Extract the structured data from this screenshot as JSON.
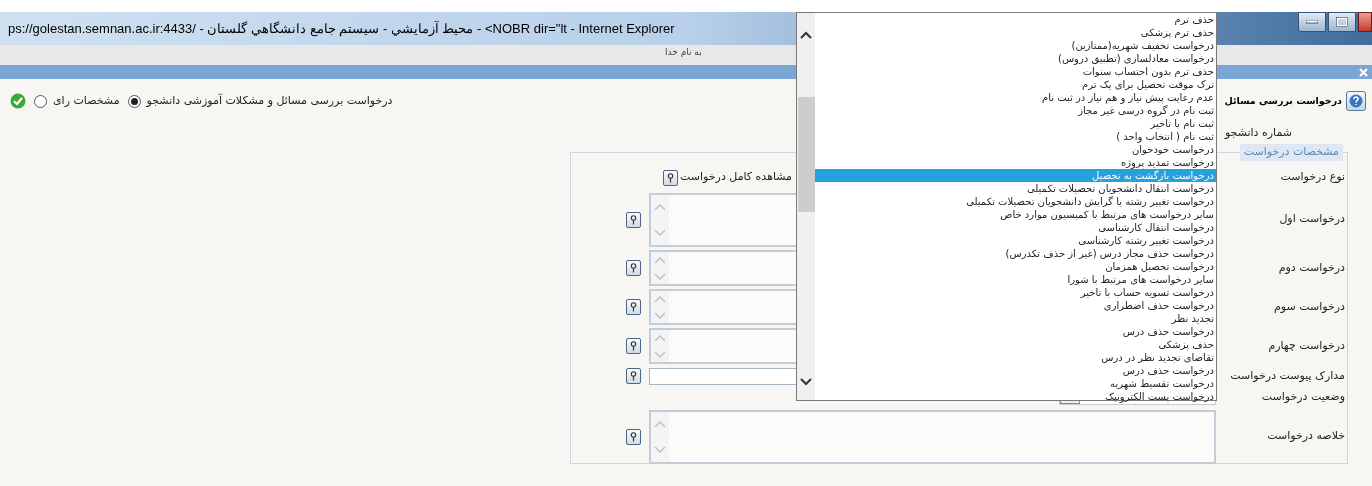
{
  "window": {
    "title": "ps://golestan.semnan.ac.ir:4433/ - محيط آزمايشي - سيستم جامع دانشگاهي گلستان - <NOBR dir=\"lt - Internet Explorer"
  },
  "header": {
    "greeting": "به نام خدا"
  },
  "mode_options": [
    {
      "label": "درخواست بررسی مسائل و مشکلات آموزشی دانشجو",
      "selected": true
    },
    {
      "label": "مشخصات رای",
      "selected": false
    }
  ],
  "form": {
    "title": "درخواست بررسی مسائل",
    "student_number_label": "شماره دانشجو",
    "section_legend": "مشخصات درخواست",
    "fields": [
      {
        "label": "نوع درخواست",
        "kind": "link",
        "link": "مشاهده کامل درخواست"
      },
      {
        "label": "درخواست اول",
        "kind": "large_textarea"
      },
      {
        "label": "درخواست دوم",
        "kind": "textarea"
      },
      {
        "label": "درخواست سوم",
        "kind": "textarea"
      },
      {
        "label": "درخواست چهارم",
        "kind": "textarea"
      },
      {
        "label": "مدارک پیوست درخواست",
        "kind": "input"
      },
      {
        "label": "وضعیت درخواست",
        "kind": "select"
      },
      {
        "label": "خلاصه درخواست",
        "kind": "large_textarea"
      }
    ]
  },
  "dropdown": {
    "options": [
      {
        "label": "حذف ترم",
        "selected": false
      },
      {
        "label": "حذف ترم پزشکی",
        "selected": false
      },
      {
        "label": "درخواست تخفیف شهریه(ممتازین)",
        "selected": false
      },
      {
        "label": "درخواست معادلسازی (تطبیق دروس)",
        "selected": false
      },
      {
        "label": "حذف ترم بدون احتساب سنوات",
        "selected": false
      },
      {
        "label": "ترک موقت تحصیل برای یک ترم",
        "selected": false
      },
      {
        "label": "عدم رعایت پیش نیاز و هم نیاز در ثبت نام",
        "selected": false
      },
      {
        "label": "ثبت نام در گروه درسی غیر مجاز",
        "selected": false
      },
      {
        "label": "ثبت نام با تاخیر",
        "selected": false
      },
      {
        "label": "ثبت نام ( انتخاب واحد )",
        "selected": false
      },
      {
        "label": "درخواست خودخوان",
        "selected": false
      },
      {
        "label": "درخواست تمدید پروژه",
        "selected": false
      },
      {
        "label": "درخواست بازگشت به تحصیل",
        "selected": true
      },
      {
        "label": "درخواست انتقال دانشجویان تحصیلات تکمیلی",
        "selected": false
      },
      {
        "label": "درخواست تغییر رشته یا گرایش دانشجویان تحصیلات تکمیلی",
        "selected": false
      },
      {
        "label": "سایر درخواست های مرتبط با کمیسیون موارد خاص",
        "selected": false
      },
      {
        "label": "درخواست انتقال کارشناسی",
        "selected": false
      },
      {
        "label": "درخواست تغییر رشته کارشناسی",
        "selected": false
      },
      {
        "label": "درخواست حذف مجاز درس (غیر از حذف تکدرس)",
        "selected": false
      },
      {
        "label": "درخواست تحصیل همزمان",
        "selected": false
      },
      {
        "label": "سایر درخواست های مرتبط با شورا",
        "selected": false
      },
      {
        "label": "درخواست تسویه حساب با تاخیر",
        "selected": false
      },
      {
        "label": "درخواست حذف اضطراری",
        "selected": false
      },
      {
        "label": "تجدید نظر",
        "selected": false
      },
      {
        "label": "درخواست حذف درس",
        "selected": false
      },
      {
        "label": "حذف پزشکی",
        "selected": false
      },
      {
        "label": "تقاضای تجدید نظر در درس",
        "selected": false
      },
      {
        "label": "درخواست حذف درس",
        "selected": false
      },
      {
        "label": "درخواست تقسیط شهریه",
        "selected": false
      },
      {
        "label": "درخواست پست الکترونیک",
        "selected": false
      }
    ]
  }
}
